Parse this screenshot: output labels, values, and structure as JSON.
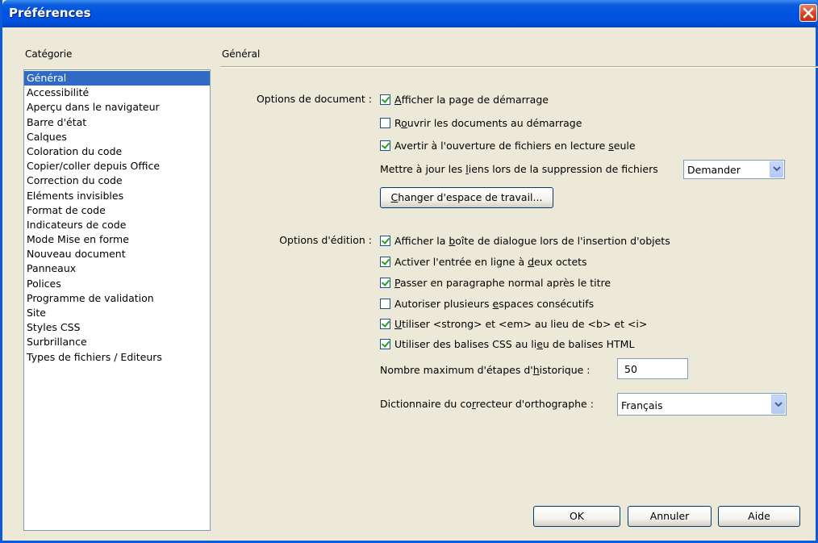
{
  "window": {
    "title": "Préférences"
  },
  "category": {
    "label": "Catégorie",
    "items": [
      "Général",
      "Accessibilité",
      "Aperçu dans le navigateur",
      "Barre d'état",
      "Calques",
      "Coloration du code",
      "Copier/coller depuis Office",
      "Correction du code",
      "Eléments invisibles",
      "Format de code",
      "Indicateurs de code",
      "Mode Mise en forme",
      "Nouveau document",
      "Panneaux",
      "Polices",
      "Programme de validation",
      "Site",
      "Styles CSS",
      "Surbrillance",
      "Types de fichiers / Editeurs"
    ],
    "selected": "Général"
  },
  "panel": {
    "title": "Général",
    "doc_options_label": "Options de document :",
    "doc_options": [
      {
        "pre": "",
        "u": "A",
        "post": "fficher la page de démarrage",
        "checked": true
      },
      {
        "pre": "R",
        "u": "o",
        "post": "uvrir les documents au démarrage",
        "checked": false
      },
      {
        "pre": "Avertir à l'ouverture de fichiers en lecture ",
        "u": "s",
        "post": "eule",
        "checked": true
      }
    ],
    "update_links": {
      "pre": "Mettre à jour les ",
      "u": "l",
      "post": "iens lors de la suppression de fichiers",
      "value": "Demander"
    },
    "workspace_button": {
      "u": "C",
      "post": "hanger d'espace de travail..."
    },
    "edit_options_label": "Options d'édition :",
    "edit_options": [
      {
        "pre": "Afficher la ",
        "u": "b",
        "post": "oîte de dialogue lors de l'insertion d'objets",
        "checked": true
      },
      {
        "pre": "Activer l'entrée en ligne à ",
        "u": "d",
        "post": "eux octets",
        "checked": true
      },
      {
        "pre": "",
        "u": "P",
        "post": "asser en paragraphe normal après le titre",
        "checked": true
      },
      {
        "pre": "Autoriser plusieurs ",
        "u": "e",
        "post": "spaces consécutifs",
        "checked": false
      },
      {
        "pre": "",
        "u": "U",
        "post": "tiliser <strong> et <em> au lieu de <b> et <i>",
        "checked": true
      },
      {
        "pre": "Utiliser des balises CSS au li",
        "u": "e",
        "post": "u de balises HTML",
        "checked": true
      }
    ],
    "history": {
      "pre": "Nombre maximum d'étapes d'",
      "u": "h",
      "post": "istorique :",
      "value": "50"
    },
    "dictionary": {
      "pre": "Dictionnaire du co",
      "u": "r",
      "post": "recteur d'orthographe :",
      "value": "Français"
    }
  },
  "buttons": {
    "ok": "OK",
    "cancel": "Annuler",
    "help": "Aide"
  },
  "colors": {
    "titlebar": "#0053E2",
    "selection": "#316AC5",
    "dialog_bg": "#ECE9D8"
  }
}
